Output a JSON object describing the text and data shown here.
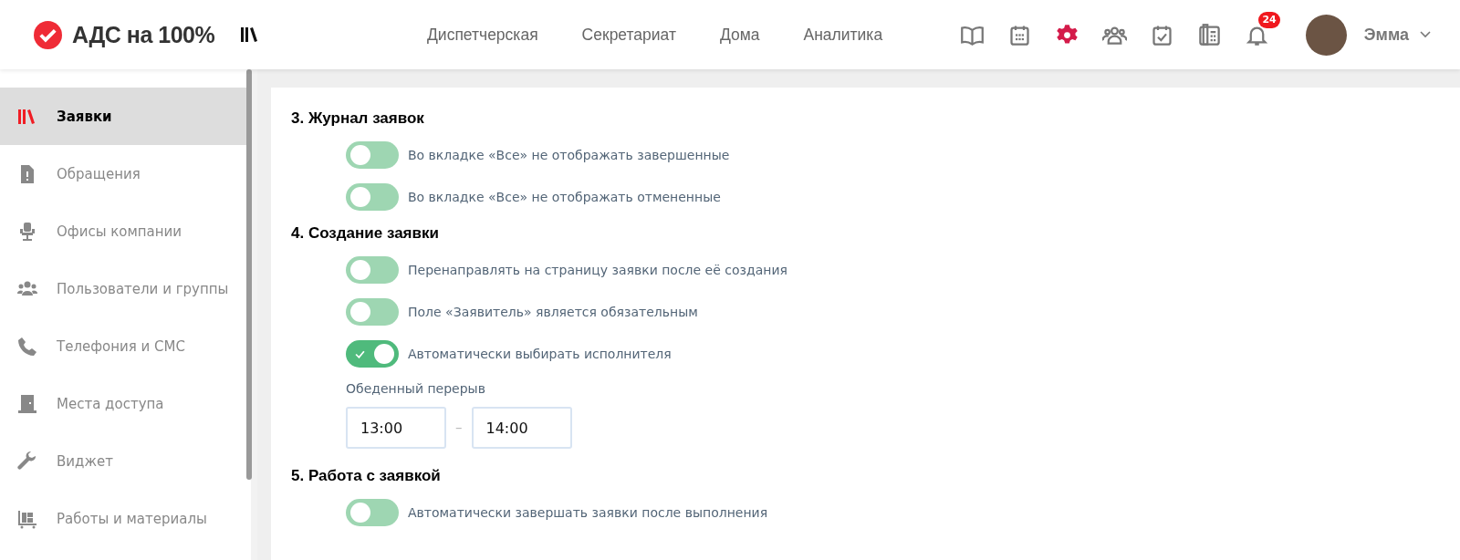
{
  "header": {
    "logo_text": "АДС на 100%",
    "nav": [
      {
        "label": "Диспетчерская"
      },
      {
        "label": "Секретариат"
      },
      {
        "label": "Дома"
      },
      {
        "label": "Аналитика"
      }
    ],
    "tools": [
      {
        "kind": "book",
        "selected": false
      },
      {
        "kind": "calendar",
        "selected": false
      },
      {
        "kind": "gear",
        "selected": true
      },
      {
        "kind": "users",
        "selected": false
      },
      {
        "kind": "calendar-check",
        "selected": false
      },
      {
        "kind": "phone",
        "selected": false
      },
      {
        "kind": "bell",
        "selected": false,
        "badge": "24"
      }
    ],
    "user": {
      "name": "Эмма"
    }
  },
  "sidebar": {
    "items": [
      {
        "label": "Заявки",
        "selected": true
      },
      {
        "label": "Обращения",
        "selected": false
      },
      {
        "label": "Офисы компании",
        "selected": false
      },
      {
        "label": "Пользователи и группы",
        "selected": false
      },
      {
        "label": "Телефония и СМС",
        "selected": false
      },
      {
        "label": "Места доступа",
        "selected": false
      },
      {
        "label": "Виджет",
        "selected": false
      },
      {
        "label": "Работы и материалы",
        "selected": false
      }
    ]
  },
  "sections": [
    {
      "title": "3. Журнал заявок",
      "items": [
        {
          "kind": "toggle",
          "label": "Во вкладке «Все» не отображать завершенные",
          "on": false
        },
        {
          "kind": "toggle",
          "label": "Во вкладке «Все» не отображать отмененные",
          "on": false
        }
      ]
    },
    {
      "title": "4. Создание заявки",
      "items": [
        {
          "kind": "toggle",
          "label": "Перенаправлять на страницу заявки после её создания",
          "on": false
        },
        {
          "kind": "toggle",
          "label": "Поле «Заявитель» является обязательным",
          "on": false
        },
        {
          "kind": "toggle",
          "label": "Автоматически выбирать исполнителя",
          "on": true
        },
        {
          "kind": "time_range",
          "label": "Обеденный перерыв",
          "from": "13:00",
          "separator": "–",
          "to": "14:00"
        }
      ]
    },
    {
      "title": "5. Работа с заявкой",
      "items": [
        {
          "kind": "toggle",
          "label": "Автоматически завершать заявки после выполнения",
          "on": false
        }
      ]
    }
  ]
}
